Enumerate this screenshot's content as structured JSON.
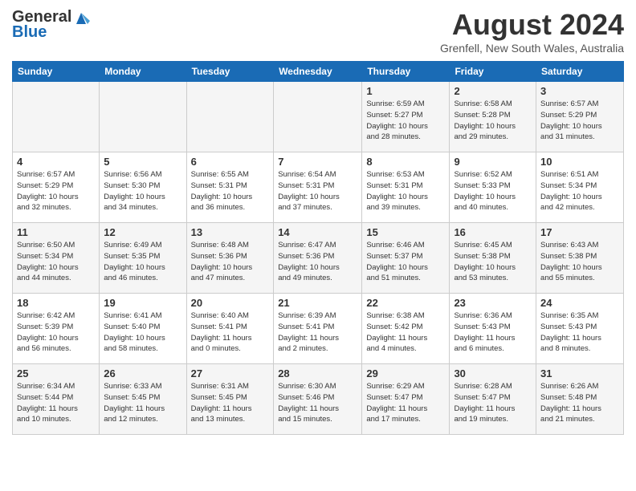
{
  "header": {
    "logo_general": "General",
    "logo_blue": "Blue",
    "month_year": "August 2024",
    "location": "Grenfell, New South Wales, Australia"
  },
  "days_of_week": [
    "Sunday",
    "Monday",
    "Tuesday",
    "Wednesday",
    "Thursday",
    "Friday",
    "Saturday"
  ],
  "weeks": [
    [
      {
        "day": "",
        "info": ""
      },
      {
        "day": "",
        "info": ""
      },
      {
        "day": "",
        "info": ""
      },
      {
        "day": "",
        "info": ""
      },
      {
        "day": "1",
        "info": "Sunrise: 6:59 AM\nSunset: 5:27 PM\nDaylight: 10 hours\nand 28 minutes."
      },
      {
        "day": "2",
        "info": "Sunrise: 6:58 AM\nSunset: 5:28 PM\nDaylight: 10 hours\nand 29 minutes."
      },
      {
        "day": "3",
        "info": "Sunrise: 6:57 AM\nSunset: 5:29 PM\nDaylight: 10 hours\nand 31 minutes."
      }
    ],
    [
      {
        "day": "4",
        "info": "Sunrise: 6:57 AM\nSunset: 5:29 PM\nDaylight: 10 hours\nand 32 minutes."
      },
      {
        "day": "5",
        "info": "Sunrise: 6:56 AM\nSunset: 5:30 PM\nDaylight: 10 hours\nand 34 minutes."
      },
      {
        "day": "6",
        "info": "Sunrise: 6:55 AM\nSunset: 5:31 PM\nDaylight: 10 hours\nand 36 minutes."
      },
      {
        "day": "7",
        "info": "Sunrise: 6:54 AM\nSunset: 5:31 PM\nDaylight: 10 hours\nand 37 minutes."
      },
      {
        "day": "8",
        "info": "Sunrise: 6:53 AM\nSunset: 5:31 PM\nDaylight: 10 hours\nand 39 minutes."
      },
      {
        "day": "9",
        "info": "Sunrise: 6:52 AM\nSunset: 5:33 PM\nDaylight: 10 hours\nand 40 minutes."
      },
      {
        "day": "10",
        "info": "Sunrise: 6:51 AM\nSunset: 5:34 PM\nDaylight: 10 hours\nand 42 minutes."
      }
    ],
    [
      {
        "day": "11",
        "info": "Sunrise: 6:50 AM\nSunset: 5:34 PM\nDaylight: 10 hours\nand 44 minutes."
      },
      {
        "day": "12",
        "info": "Sunrise: 6:49 AM\nSunset: 5:35 PM\nDaylight: 10 hours\nand 46 minutes."
      },
      {
        "day": "13",
        "info": "Sunrise: 6:48 AM\nSunset: 5:36 PM\nDaylight: 10 hours\nand 47 minutes."
      },
      {
        "day": "14",
        "info": "Sunrise: 6:47 AM\nSunset: 5:36 PM\nDaylight: 10 hours\nand 49 minutes."
      },
      {
        "day": "15",
        "info": "Sunrise: 6:46 AM\nSunset: 5:37 PM\nDaylight: 10 hours\nand 51 minutes."
      },
      {
        "day": "16",
        "info": "Sunrise: 6:45 AM\nSunset: 5:38 PM\nDaylight: 10 hours\nand 53 minutes."
      },
      {
        "day": "17",
        "info": "Sunrise: 6:43 AM\nSunset: 5:38 PM\nDaylight: 10 hours\nand 55 minutes."
      }
    ],
    [
      {
        "day": "18",
        "info": "Sunrise: 6:42 AM\nSunset: 5:39 PM\nDaylight: 10 hours\nand 56 minutes."
      },
      {
        "day": "19",
        "info": "Sunrise: 6:41 AM\nSunset: 5:40 PM\nDaylight: 10 hours\nand 58 minutes."
      },
      {
        "day": "20",
        "info": "Sunrise: 6:40 AM\nSunset: 5:41 PM\nDaylight: 11 hours\nand 0 minutes."
      },
      {
        "day": "21",
        "info": "Sunrise: 6:39 AM\nSunset: 5:41 PM\nDaylight: 11 hours\nand 2 minutes."
      },
      {
        "day": "22",
        "info": "Sunrise: 6:38 AM\nSunset: 5:42 PM\nDaylight: 11 hours\nand 4 minutes."
      },
      {
        "day": "23",
        "info": "Sunrise: 6:36 AM\nSunset: 5:43 PM\nDaylight: 11 hours\nand 6 minutes."
      },
      {
        "day": "24",
        "info": "Sunrise: 6:35 AM\nSunset: 5:43 PM\nDaylight: 11 hours\nand 8 minutes."
      }
    ],
    [
      {
        "day": "25",
        "info": "Sunrise: 6:34 AM\nSunset: 5:44 PM\nDaylight: 11 hours\nand 10 minutes."
      },
      {
        "day": "26",
        "info": "Sunrise: 6:33 AM\nSunset: 5:45 PM\nDaylight: 11 hours\nand 12 minutes."
      },
      {
        "day": "27",
        "info": "Sunrise: 6:31 AM\nSunset: 5:45 PM\nDaylight: 11 hours\nand 13 minutes."
      },
      {
        "day": "28",
        "info": "Sunrise: 6:30 AM\nSunset: 5:46 PM\nDaylight: 11 hours\nand 15 minutes."
      },
      {
        "day": "29",
        "info": "Sunrise: 6:29 AM\nSunset: 5:47 PM\nDaylight: 11 hours\nand 17 minutes."
      },
      {
        "day": "30",
        "info": "Sunrise: 6:28 AM\nSunset: 5:47 PM\nDaylight: 11 hours\nand 19 minutes."
      },
      {
        "day": "31",
        "info": "Sunrise: 6:26 AM\nSunset: 5:48 PM\nDaylight: 11 hours\nand 21 minutes."
      }
    ]
  ]
}
